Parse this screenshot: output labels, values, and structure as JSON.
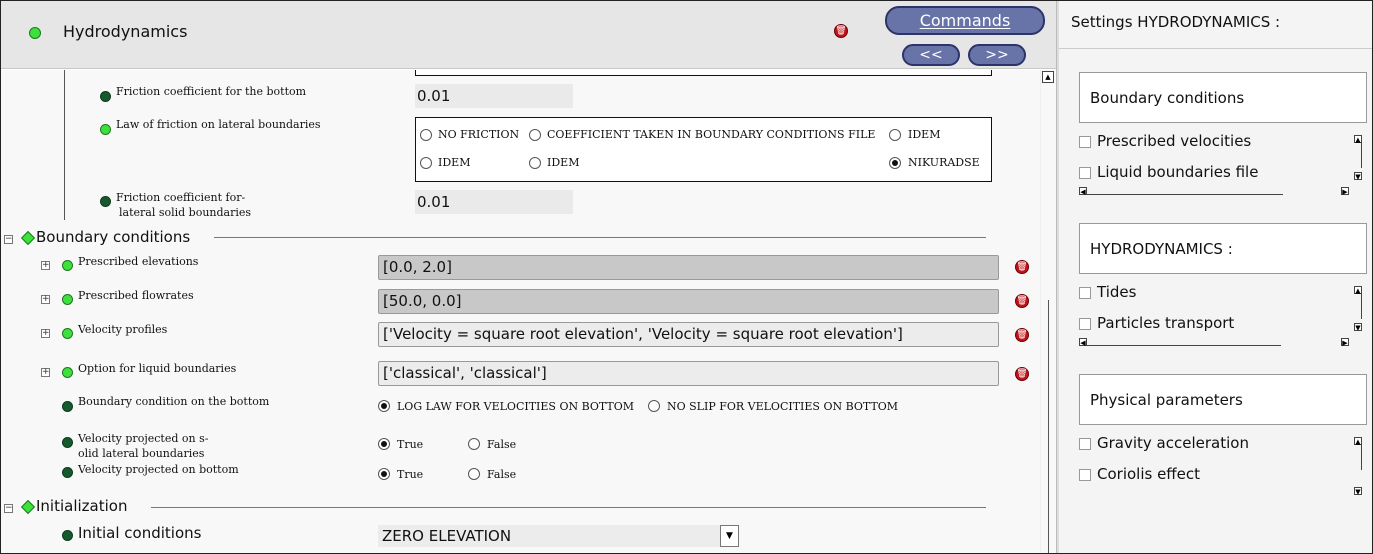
{
  "header": {
    "title": "Hydrodynamics",
    "commands_label": "Commands",
    "prev_label": "<<",
    "next_label": ">>"
  },
  "friction": {
    "bottom_coef_label": "Friction coefficient for the bottom",
    "bottom_coef_value": "0.01",
    "lateral_law_label": "Law of friction on lateral boundaries",
    "lateral_law_options": [
      "NO FRICTION",
      "COEFFICIENT TAKEN IN BOUNDARY CONDITIONS FILE",
      "IDEM",
      "IDEM",
      "IDEM",
      "NIKURADSE"
    ],
    "lateral_law_selected": "NIKURADSE",
    "lateral_coef_label_1": "Friction coefficient for-",
    "lateral_coef_label_2": "lateral solid boundaries",
    "lateral_coef_value": "0.01"
  },
  "boundary": {
    "section_title": "Boundary conditions",
    "rows": [
      {
        "label": "Prescribed elevations",
        "value": "[0.0, 2.0]"
      },
      {
        "label": "Prescribed flowrates",
        "value": "[50.0, 0.0]"
      },
      {
        "label": "Velocity profiles",
        "value": "['Velocity = square root elevation', 'Velocity = square root elevation']"
      },
      {
        "label": "Option for liquid boundaries",
        "value": "['classical', 'classical']"
      }
    ],
    "bottom_bc_label": "Boundary condition on the bottom",
    "bottom_bc_options": [
      "LOG LAW FOR VELOCITIES ON BOTTOM",
      "NO SLIP FOR VELOCITIES ON BOTTOM"
    ],
    "bottom_bc_selected": "LOG LAW FOR VELOCITIES ON BOTTOM",
    "vel_proj_lateral_label_1": "Velocity projected on s-",
    "vel_proj_lateral_label_2": "olid lateral boundaries",
    "vel_proj_lateral_options": [
      "True",
      "False"
    ],
    "vel_proj_lateral_selected": "True",
    "vel_proj_bottom_label": "Velocity projected on bottom",
    "vel_proj_bottom_options": [
      "True",
      "False"
    ],
    "vel_proj_bottom_selected": "True"
  },
  "initialization": {
    "section_title": "Initialization",
    "initial_conditions_label": "Initial conditions",
    "initial_conditions_value": "ZERO ELEVATION"
  },
  "settings_panel": {
    "title": "Settings HYDRODYNAMICS :",
    "groups": [
      {
        "title": "Boundary conditions",
        "items": [
          "Prescribed velocities",
          "Liquid boundaries file"
        ]
      },
      {
        "title": "HYDRODYNAMICS :",
        "items": [
          "Tides",
          "Particles transport"
        ]
      },
      {
        "title": "Physical parameters",
        "items": [
          "Gravity acceleration",
          "Coriolis effect"
        ]
      }
    ]
  },
  "colors": {
    "button_fill": "#6874a8",
    "active_dot": "#3de03d",
    "inactive_dot": "#145a2e",
    "delete_icon": "#c0141a"
  }
}
